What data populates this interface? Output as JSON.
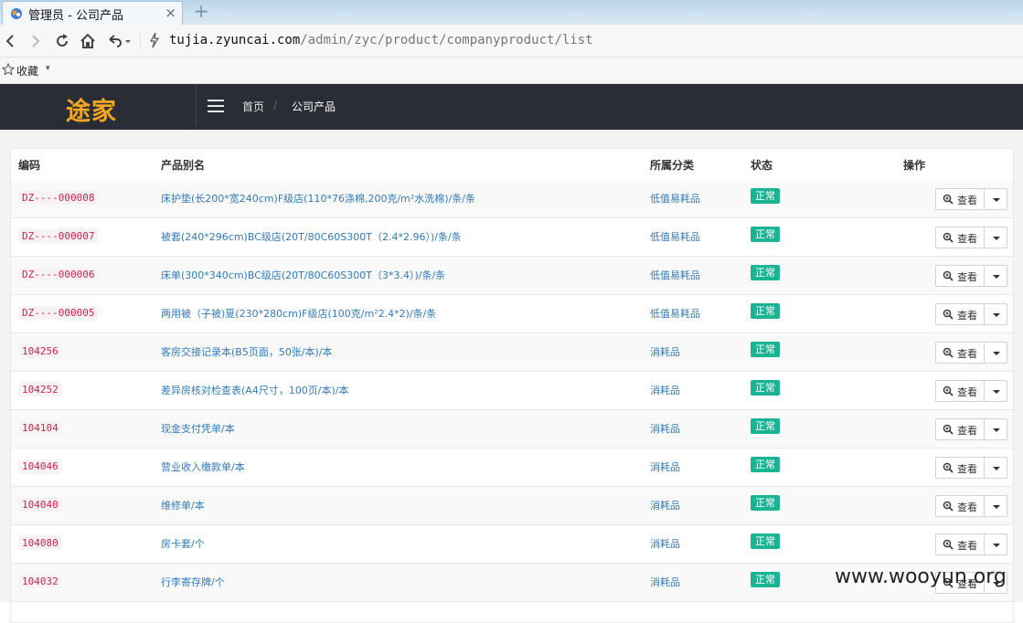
{
  "browser": {
    "tab_title": "管理员 - 公司产品",
    "tab_close": "×",
    "new_tab": "+",
    "url_host": "tujia.zyuncai.com",
    "url_path": "/admin/zyc/product/companyproduct/list",
    "favorites_label": "收藏",
    "favorites_caret": "▾"
  },
  "app": {
    "logo_text": "途家",
    "breadcrumb": {
      "home": "首页",
      "separator": "/",
      "current": "公司产品"
    }
  },
  "table": {
    "headers": {
      "code": "编码",
      "name": "产品别名",
      "category": "所属分类",
      "status": "状态",
      "actions": "操作"
    },
    "view_label": "查看",
    "rows": [
      {
        "code": "DZ----000008",
        "name": "床护垫(长200*宽240cm)F级店(110*76涤棉,200克/m²水洗棉)/条/条",
        "category": "低值易耗品",
        "status": "正常"
      },
      {
        "code": "DZ----000007",
        "name": "被套(240*296cm)BC级店(20T/80C60S300T（2.4*2.96）)/条/条",
        "category": "低值易耗品",
        "status": "正常"
      },
      {
        "code": "DZ----000006",
        "name": "床单(300*340cm)BC级店(20T/80C60S300T（3*3.4）)/条/条",
        "category": "低值易耗品",
        "status": "正常"
      },
      {
        "code": "DZ----000005",
        "name": "两用被（子被)夏(230*280cm)F级店(100克/m²2.4*2)/条/条",
        "category": "低值易耗品",
        "status": "正常"
      },
      {
        "code": "104256",
        "name": "客房交接记录本(B5页面，50张/本)/本",
        "category": "消耗品",
        "status": "正常"
      },
      {
        "code": "104252",
        "name": "差异房核对检查表(A4尺寸，100页/本)/本",
        "category": "消耗品",
        "status": "正常"
      },
      {
        "code": "104104",
        "name": "现金支付凭单/本",
        "category": "消耗品",
        "status": "正常"
      },
      {
        "code": "104046",
        "name": "营业收入缴款单/本",
        "category": "消耗品",
        "status": "正常"
      },
      {
        "code": "104040",
        "name": "维修单/本",
        "category": "消耗品",
        "status": "正常"
      },
      {
        "code": "104080",
        "name": "房卡套/个",
        "category": "消耗品",
        "status": "正常"
      },
      {
        "code": "104032",
        "name": "行李寄存牌/个",
        "category": "消耗品",
        "status": "正常"
      }
    ]
  },
  "watermark": "www.wooyun.org",
  "colors": {
    "header_bg": "#2a2d35",
    "badge": "#1ab394",
    "link": "#337ab7",
    "code": "#c7254e",
    "logo": "#f5a623"
  }
}
